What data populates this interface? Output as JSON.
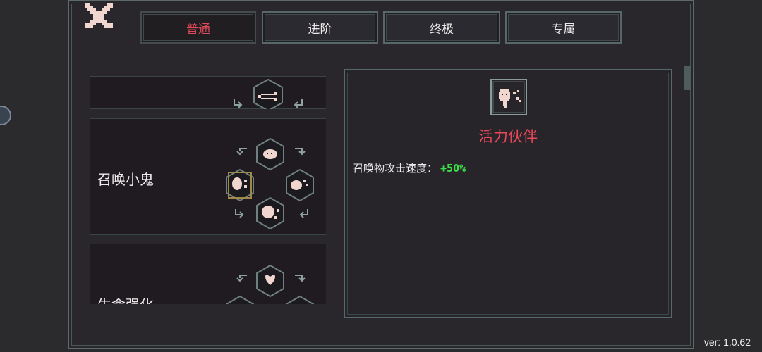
{
  "tabs": [
    {
      "label": "普通",
      "active": true
    },
    {
      "label": "进阶",
      "active": false
    },
    {
      "label": "终极",
      "active": false
    },
    {
      "label": "专属",
      "active": false
    }
  ],
  "skill_list": [
    {
      "name": ""
    },
    {
      "name": "召唤小鬼"
    },
    {
      "name": "生命强化"
    }
  ],
  "detail": {
    "icon": "ghost-summon-icon",
    "title": "活力伙伴",
    "stat_label": "召唤物攻击速度：",
    "stat_value": "+50%"
  },
  "colors": {
    "accent_red": "#e04a5a",
    "stat_green": "#3de04a",
    "frame": "#5c6a6a",
    "icon_fill": "#f1d6cf"
  },
  "version": "ver: 1.0.62"
}
